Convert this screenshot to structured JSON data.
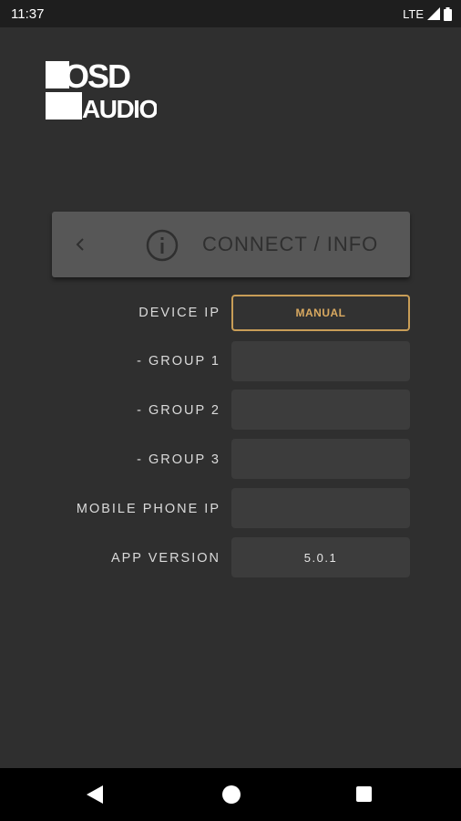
{
  "status_bar": {
    "time": "11:37",
    "network": "LTE"
  },
  "logo": {
    "line1": "OSD",
    "line2": "AUDIO"
  },
  "header": {
    "title": "CONNECT / INFO",
    "back_icon": "chevron-left-icon",
    "info_icon": "info-circle-icon"
  },
  "rows": [
    {
      "label": "DEVICE IP",
      "value": "MANUAL"
    },
    {
      "label": "- GROUP 1",
      "value": ""
    },
    {
      "label": "- GROUP 2",
      "value": ""
    },
    {
      "label": "- GROUP 3",
      "value": ""
    },
    {
      "label": "MOBILE PHONE IP",
      "value": ""
    },
    {
      "label": "APP VERSION",
      "value": "5.0.1"
    }
  ],
  "colors": {
    "background": "#2f2f2f",
    "header_card": "#575757",
    "field": "#3c3c3c",
    "accent": "#c89d57"
  }
}
